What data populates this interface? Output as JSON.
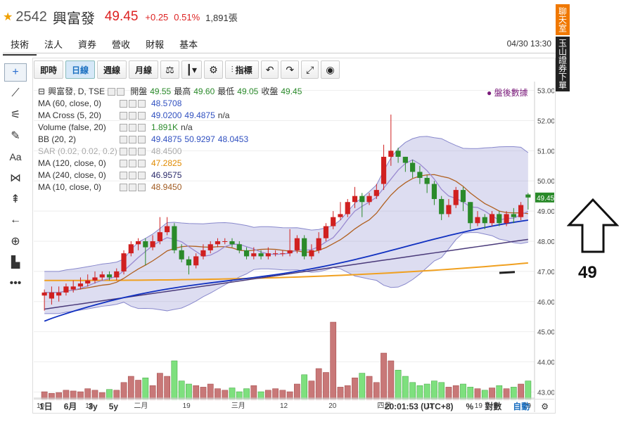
{
  "stock": {
    "code": "2542",
    "name": "興富發",
    "price": "49.45",
    "change": "+0.25",
    "change_pct": "0.51%",
    "volume": "1,891張"
  },
  "tabs": [
    {
      "label": "技術",
      "active": true
    },
    {
      "label": "法人"
    },
    {
      "label": "資券"
    },
    {
      "label": "營收"
    },
    {
      "label": "財報"
    },
    {
      "label": "基本"
    }
  ],
  "datetime": "04/30 13:30",
  "toolbar": {
    "intraday": "即時",
    "daily": "日線",
    "weekly": "週線",
    "monthly": "月線",
    "indicators": "指標"
  },
  "side_panel": {
    "chat": "聊天室",
    "trade": "玉山證券下單"
  },
  "legend": {
    "title_row": {
      "name": "興富發, D, TSE",
      "open_l": "開盤",
      "open": "49.55",
      "high_l": "最高",
      "high": "49.60",
      "low_l": "最低",
      "low": "49.05",
      "close_l": "收盤",
      "close": "49.45"
    },
    "rows": [
      {
        "label": "MA (60, close, 0)",
        "values": [
          "48.5708"
        ],
        "cls": [
          "v-blue"
        ]
      },
      {
        "label": "MA Cross (5, 20)",
        "values": [
          "49.0200",
          "49.4875",
          "n/a"
        ],
        "cls": [
          "v-blue",
          "v-blue",
          ""
        ]
      },
      {
        "label": "Volume (false, 20)",
        "values": [
          "1.891K",
          "n/a"
        ],
        "cls": [
          "v-green",
          ""
        ]
      },
      {
        "label": "BB (20, 2)",
        "values": [
          "49.4875",
          "50.9297",
          "48.0453"
        ],
        "cls": [
          "v-blue",
          "v-blue",
          "v-blue"
        ]
      },
      {
        "label": "SAR (0.02, 0.02, 0.2)",
        "values": [
          "48.4500"
        ],
        "cls": [
          ""
        ],
        "muted": true
      },
      {
        "label": "MA (120, close, 0)",
        "values": [
          "47.2825"
        ],
        "cls": [
          "v-orange"
        ]
      },
      {
        "label": "MA (240, close, 0)",
        "values": [
          "46.9575"
        ],
        "cls": [
          "v-navy"
        ]
      },
      {
        "label": "MA (10, close, 0)",
        "values": [
          "48.9450"
        ],
        "cls": [
          "v-brown"
        ]
      }
    ],
    "after_hours": "盤後數據"
  },
  "price_axis": {
    "ticks": [
      "53.00",
      "52.00",
      "51.00",
      "50.00",
      "49.00",
      "48.00",
      "47.00",
      "46.00",
      "45.00",
      "44.00",
      "43.00"
    ],
    "last": "49.45"
  },
  "time_axis": [
    "10",
    "18",
    "二月",
    "19",
    "三月",
    "12",
    "20",
    "四月",
    "11",
    "19",
    "29"
  ],
  "bottom_bar": {
    "ranges": [
      "1日",
      "6月",
      "3y",
      "5y"
    ],
    "clock": "20:01:53 (UTC+8)",
    "percent": "%",
    "log": "對數",
    "auto": "自動"
  },
  "annotation": {
    "value": "49"
  },
  "chart_data": {
    "type": "candlestick",
    "ylim": [
      42.8,
      53.2
    ],
    "candles": [
      {
        "o": 46.2,
        "c": 46.3,
        "h": 46.4,
        "l": 45.7
      },
      {
        "o": 46.1,
        "c": 46.3,
        "h": 46.5,
        "l": 45.9
      },
      {
        "o": 46.2,
        "c": 46.3,
        "h": 46.5,
        "l": 46.0
      },
      {
        "o": 46.3,
        "c": 46.5,
        "h": 46.6,
        "l": 46.2
      },
      {
        "o": 46.4,
        "c": 46.5,
        "h": 46.7,
        "l": 46.3
      },
      {
        "o": 46.5,
        "c": 46.6,
        "h": 46.8,
        "l": 46.4
      },
      {
        "o": 46.6,
        "c": 46.7,
        "h": 46.9,
        "l": 46.5
      },
      {
        "o": 46.7,
        "c": 46.8,
        "h": 47.0,
        "l": 46.6
      },
      {
        "o": 46.8,
        "c": 46.9,
        "h": 47.0,
        "l": 46.7
      },
      {
        "o": 46.9,
        "c": 46.8,
        "h": 47.0,
        "l": 46.7
      },
      {
        "o": 46.8,
        "c": 47.0,
        "h": 47.1,
        "l": 46.7
      },
      {
        "o": 47.0,
        "c": 47.6,
        "h": 47.7,
        "l": 46.9
      },
      {
        "o": 47.6,
        "c": 47.9,
        "h": 48.0,
        "l": 47.5
      },
      {
        "o": 47.9,
        "c": 48.0,
        "h": 48.1,
        "l": 47.7
      },
      {
        "o": 48.0,
        "c": 47.8,
        "h": 48.1,
        "l": 47.2
      },
      {
        "o": 47.8,
        "c": 48.0,
        "h": 48.2,
        "l": 47.7
      },
      {
        "o": 48.0,
        "c": 48.3,
        "h": 48.8,
        "l": 47.9
      },
      {
        "o": 48.3,
        "c": 48.5,
        "h": 48.8,
        "l": 48.2
      },
      {
        "o": 48.5,
        "c": 47.7,
        "h": 48.6,
        "l": 47.6
      },
      {
        "o": 47.7,
        "c": 47.4,
        "h": 47.9,
        "l": 47.3
      },
      {
        "o": 47.4,
        "c": 47.2,
        "h": 47.5,
        "l": 46.9
      },
      {
        "o": 47.2,
        "c": 47.5,
        "h": 47.6,
        "l": 47.1
      },
      {
        "o": 47.5,
        "c": 47.7,
        "h": 47.9,
        "l": 47.4
      },
      {
        "o": 47.7,
        "c": 47.9,
        "h": 48.0,
        "l": 47.6
      },
      {
        "o": 47.9,
        "c": 48.0,
        "h": 48.1,
        "l": 47.8
      },
      {
        "o": 48.0,
        "c": 48.0,
        "h": 48.1,
        "l": 47.9
      },
      {
        "o": 48.0,
        "c": 47.9,
        "h": 48.1,
        "l": 47.8
      },
      {
        "o": 47.9,
        "c": 47.7,
        "h": 48.0,
        "l": 47.6
      },
      {
        "o": 47.7,
        "c": 47.5,
        "h": 47.8,
        "l": 47.4
      },
      {
        "o": 47.5,
        "c": 47.6,
        "h": 47.8,
        "l": 47.4
      },
      {
        "o": 47.6,
        "c": 47.5,
        "h": 47.7,
        "l": 47.4
      },
      {
        "o": 47.5,
        "c": 47.6,
        "h": 47.8,
        "l": 47.4
      },
      {
        "o": 47.6,
        "c": 47.6,
        "h": 47.7,
        "l": 47.5
      },
      {
        "o": 47.6,
        "c": 47.6,
        "h": 47.7,
        "l": 47.5
      },
      {
        "o": 47.6,
        "c": 47.7,
        "h": 48.4,
        "l": 47.5
      },
      {
        "o": 47.7,
        "c": 48.1,
        "h": 48.2,
        "l": 47.6
      },
      {
        "o": 48.1,
        "c": 47.5,
        "h": 48.2,
        "l": 47.4
      },
      {
        "o": 47.5,
        "c": 47.7,
        "h": 47.9,
        "l": 47.4
      },
      {
        "o": 47.7,
        "c": 48.1,
        "h": 48.3,
        "l": 47.6
      },
      {
        "o": 48.1,
        "c": 48.5,
        "h": 48.6,
        "l": 48.0
      },
      {
        "o": 48.5,
        "c": 48.8,
        "h": 49.0,
        "l": 48.4
      },
      {
        "o": 48.8,
        "c": 48.9,
        "h": 49.3,
        "l": 48.7
      },
      {
        "o": 48.9,
        "c": 49.3,
        "h": 49.4,
        "l": 48.8
      },
      {
        "o": 49.3,
        "c": 49.5,
        "h": 49.8,
        "l": 49.1
      },
      {
        "o": 49.5,
        "c": 49.3,
        "h": 49.6,
        "l": 48.8
      },
      {
        "o": 49.3,
        "c": 49.5,
        "h": 49.6,
        "l": 49.2
      },
      {
        "o": 49.5,
        "c": 49.7,
        "h": 49.9,
        "l": 49.4
      },
      {
        "o": 49.9,
        "c": 50.8,
        "h": 51.2,
        "l": 49.7
      },
      {
        "o": 50.8,
        "c": 51.0,
        "h": 52.2,
        "l": 50.5
      },
      {
        "o": 51.0,
        "c": 50.8,
        "h": 51.1,
        "l": 50.6
      },
      {
        "o": 50.8,
        "c": 50.6,
        "h": 50.8,
        "l": 50.3
      },
      {
        "o": 50.6,
        "c": 50.3,
        "h": 50.7,
        "l": 50.1
      },
      {
        "o": 50.3,
        "c": 50.1,
        "h": 50.5,
        "l": 49.9
      },
      {
        "o": 50.1,
        "c": 49.9,
        "h": 50.2,
        "l": 49.6
      },
      {
        "o": 49.9,
        "c": 49.4,
        "h": 50.0,
        "l": 49.2
      },
      {
        "o": 49.4,
        "c": 48.9,
        "h": 49.5,
        "l": 48.7
      },
      {
        "o": 48.9,
        "c": 49.2,
        "h": 49.4,
        "l": 48.8
      },
      {
        "o": 49.2,
        "c": 49.7,
        "h": 49.8,
        "l": 49.1
      },
      {
        "o": 49.7,
        "c": 49.3,
        "h": 49.8,
        "l": 49.0
      },
      {
        "o": 49.3,
        "c": 48.6,
        "h": 49.3,
        "l": 48.4
      },
      {
        "o": 48.6,
        "c": 48.8,
        "h": 49.0,
        "l": 48.5
      },
      {
        "o": 48.8,
        "c": 48.6,
        "h": 48.9,
        "l": 48.4
      },
      {
        "o": 48.6,
        "c": 48.9,
        "h": 49.0,
        "l": 48.5
      },
      {
        "o": 48.9,
        "c": 48.6,
        "h": 49.0,
        "l": 48.5
      },
      {
        "o": 48.6,
        "c": 48.9,
        "h": 49.0,
        "l": 48.5
      },
      {
        "o": 48.9,
        "c": 48.8,
        "h": 49.1,
        "l": 48.6
      },
      {
        "o": 48.8,
        "c": 49.2,
        "h": 49.3,
        "l": 48.7
      },
      {
        "o": 49.55,
        "c": 49.45,
        "h": 49.6,
        "l": 49.05
      }
    ],
    "volume_scale_max": 100,
    "volume": [
      10,
      8,
      9,
      12,
      11,
      10,
      14,
      12,
      9,
      13,
      12,
      22,
      30,
      25,
      28,
      18,
      34,
      30,
      50,
      24,
      20,
      18,
      16,
      20,
      14,
      12,
      15,
      10,
      14,
      18,
      10,
      12,
      14,
      12,
      10,
      20,
      32,
      24,
      40,
      35,
      100,
      16,
      18,
      28,
      34,
      30,
      22,
      60,
      50,
      38,
      30,
      22,
      18,
      20,
      24,
      22,
      16,
      18,
      20,
      16,
      14,
      12,
      15,
      18,
      14,
      16,
      20,
      24
    ]
  }
}
